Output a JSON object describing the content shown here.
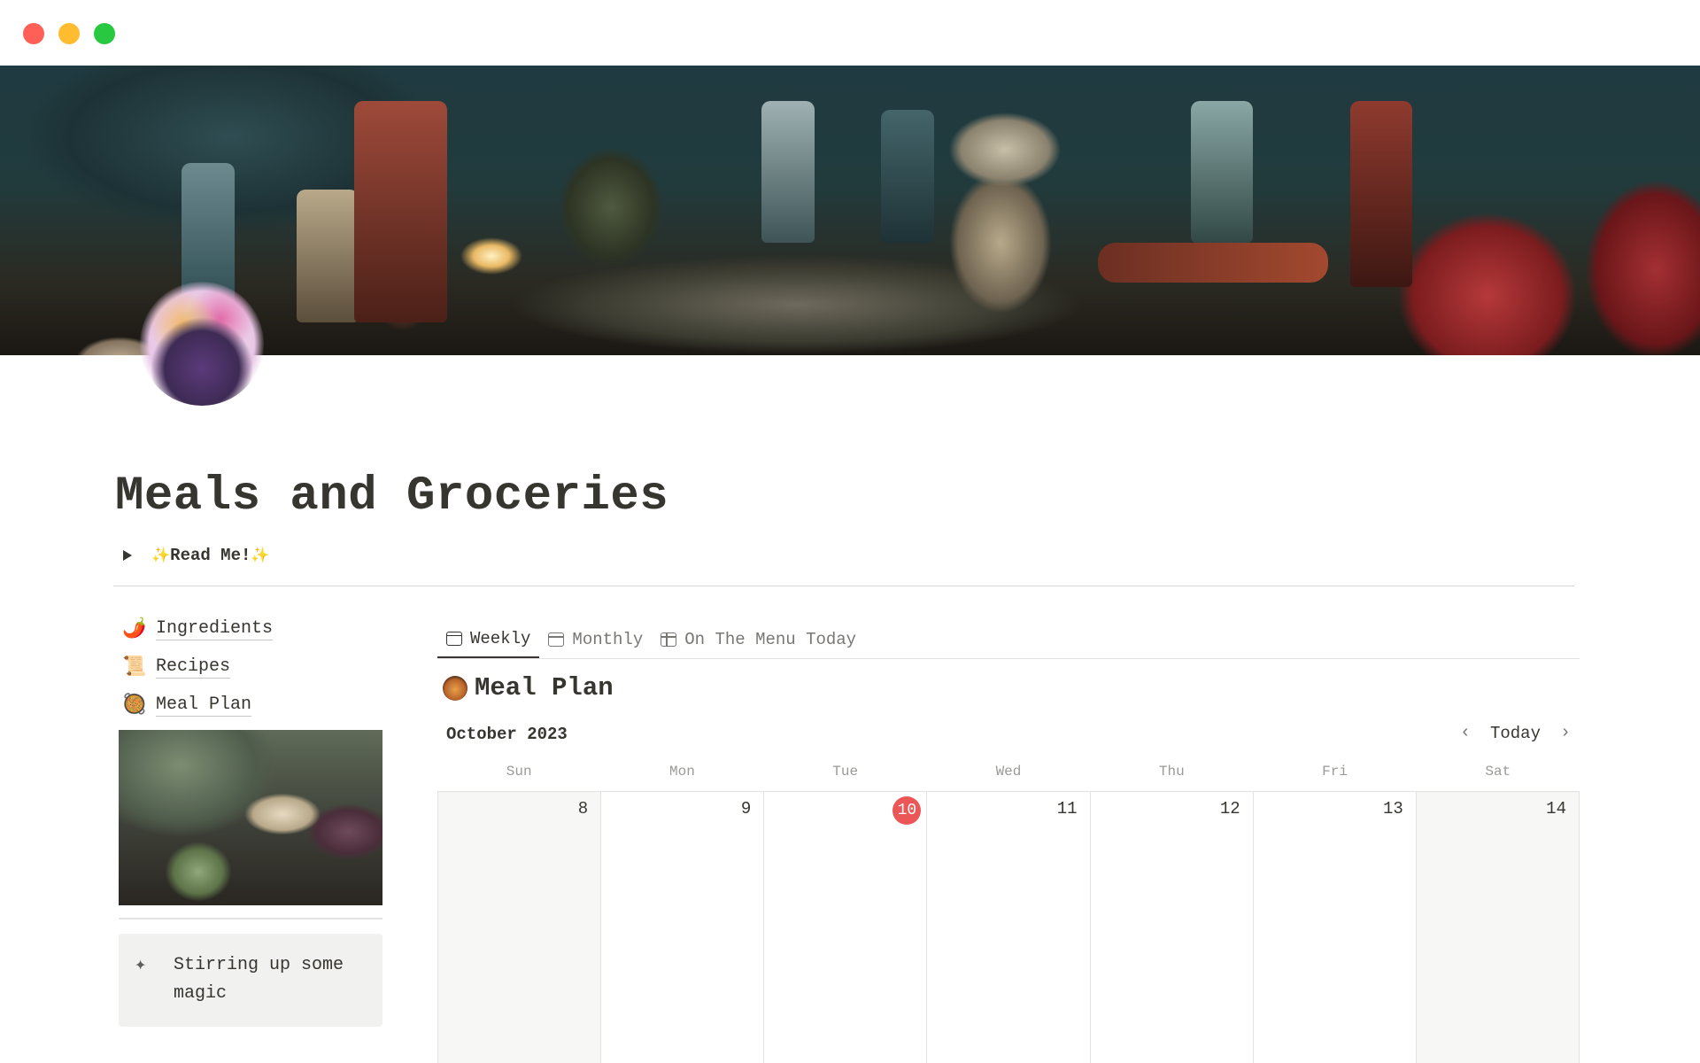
{
  "page": {
    "title": "Meals and Groceries",
    "toggle_label": "Read Me!",
    "toggle_sparkle": "✨"
  },
  "sidebar": {
    "links": [
      {
        "icon": "chili-pepper-icon",
        "emoji": "🌶️",
        "label": "Ingredients"
      },
      {
        "icon": "scroll-icon",
        "emoji": "📜",
        "label": "Recipes"
      },
      {
        "icon": "meal-plan-icon",
        "emoji": "🥘",
        "label": "Meal Plan"
      }
    ],
    "callout": {
      "icon": "sparkles-icon",
      "glyph": "✦",
      "text": "Stirring up some magic"
    }
  },
  "views": {
    "tabs": [
      {
        "label": "Weekly",
        "icon": "calendar-icon",
        "active": true
      },
      {
        "label": "Monthly",
        "icon": "calendar-icon",
        "active": false
      },
      {
        "label": "On The Menu Today",
        "icon": "table-icon",
        "active": false
      }
    ]
  },
  "calendar": {
    "title": "Meal Plan",
    "month": "October 2023",
    "today_label": "Today",
    "prev_glyph": "‹",
    "next_glyph": "›",
    "weekdays": [
      "Sun",
      "Mon",
      "Tue",
      "Wed",
      "Thu",
      "Fri",
      "Sat"
    ],
    "days": [
      "8",
      "9",
      "10",
      "11",
      "12",
      "13",
      "14"
    ],
    "today_index": 2
  },
  "colors": {
    "today_badge": "#eb5757",
    "text": "#37352f",
    "muted": "#787774"
  }
}
